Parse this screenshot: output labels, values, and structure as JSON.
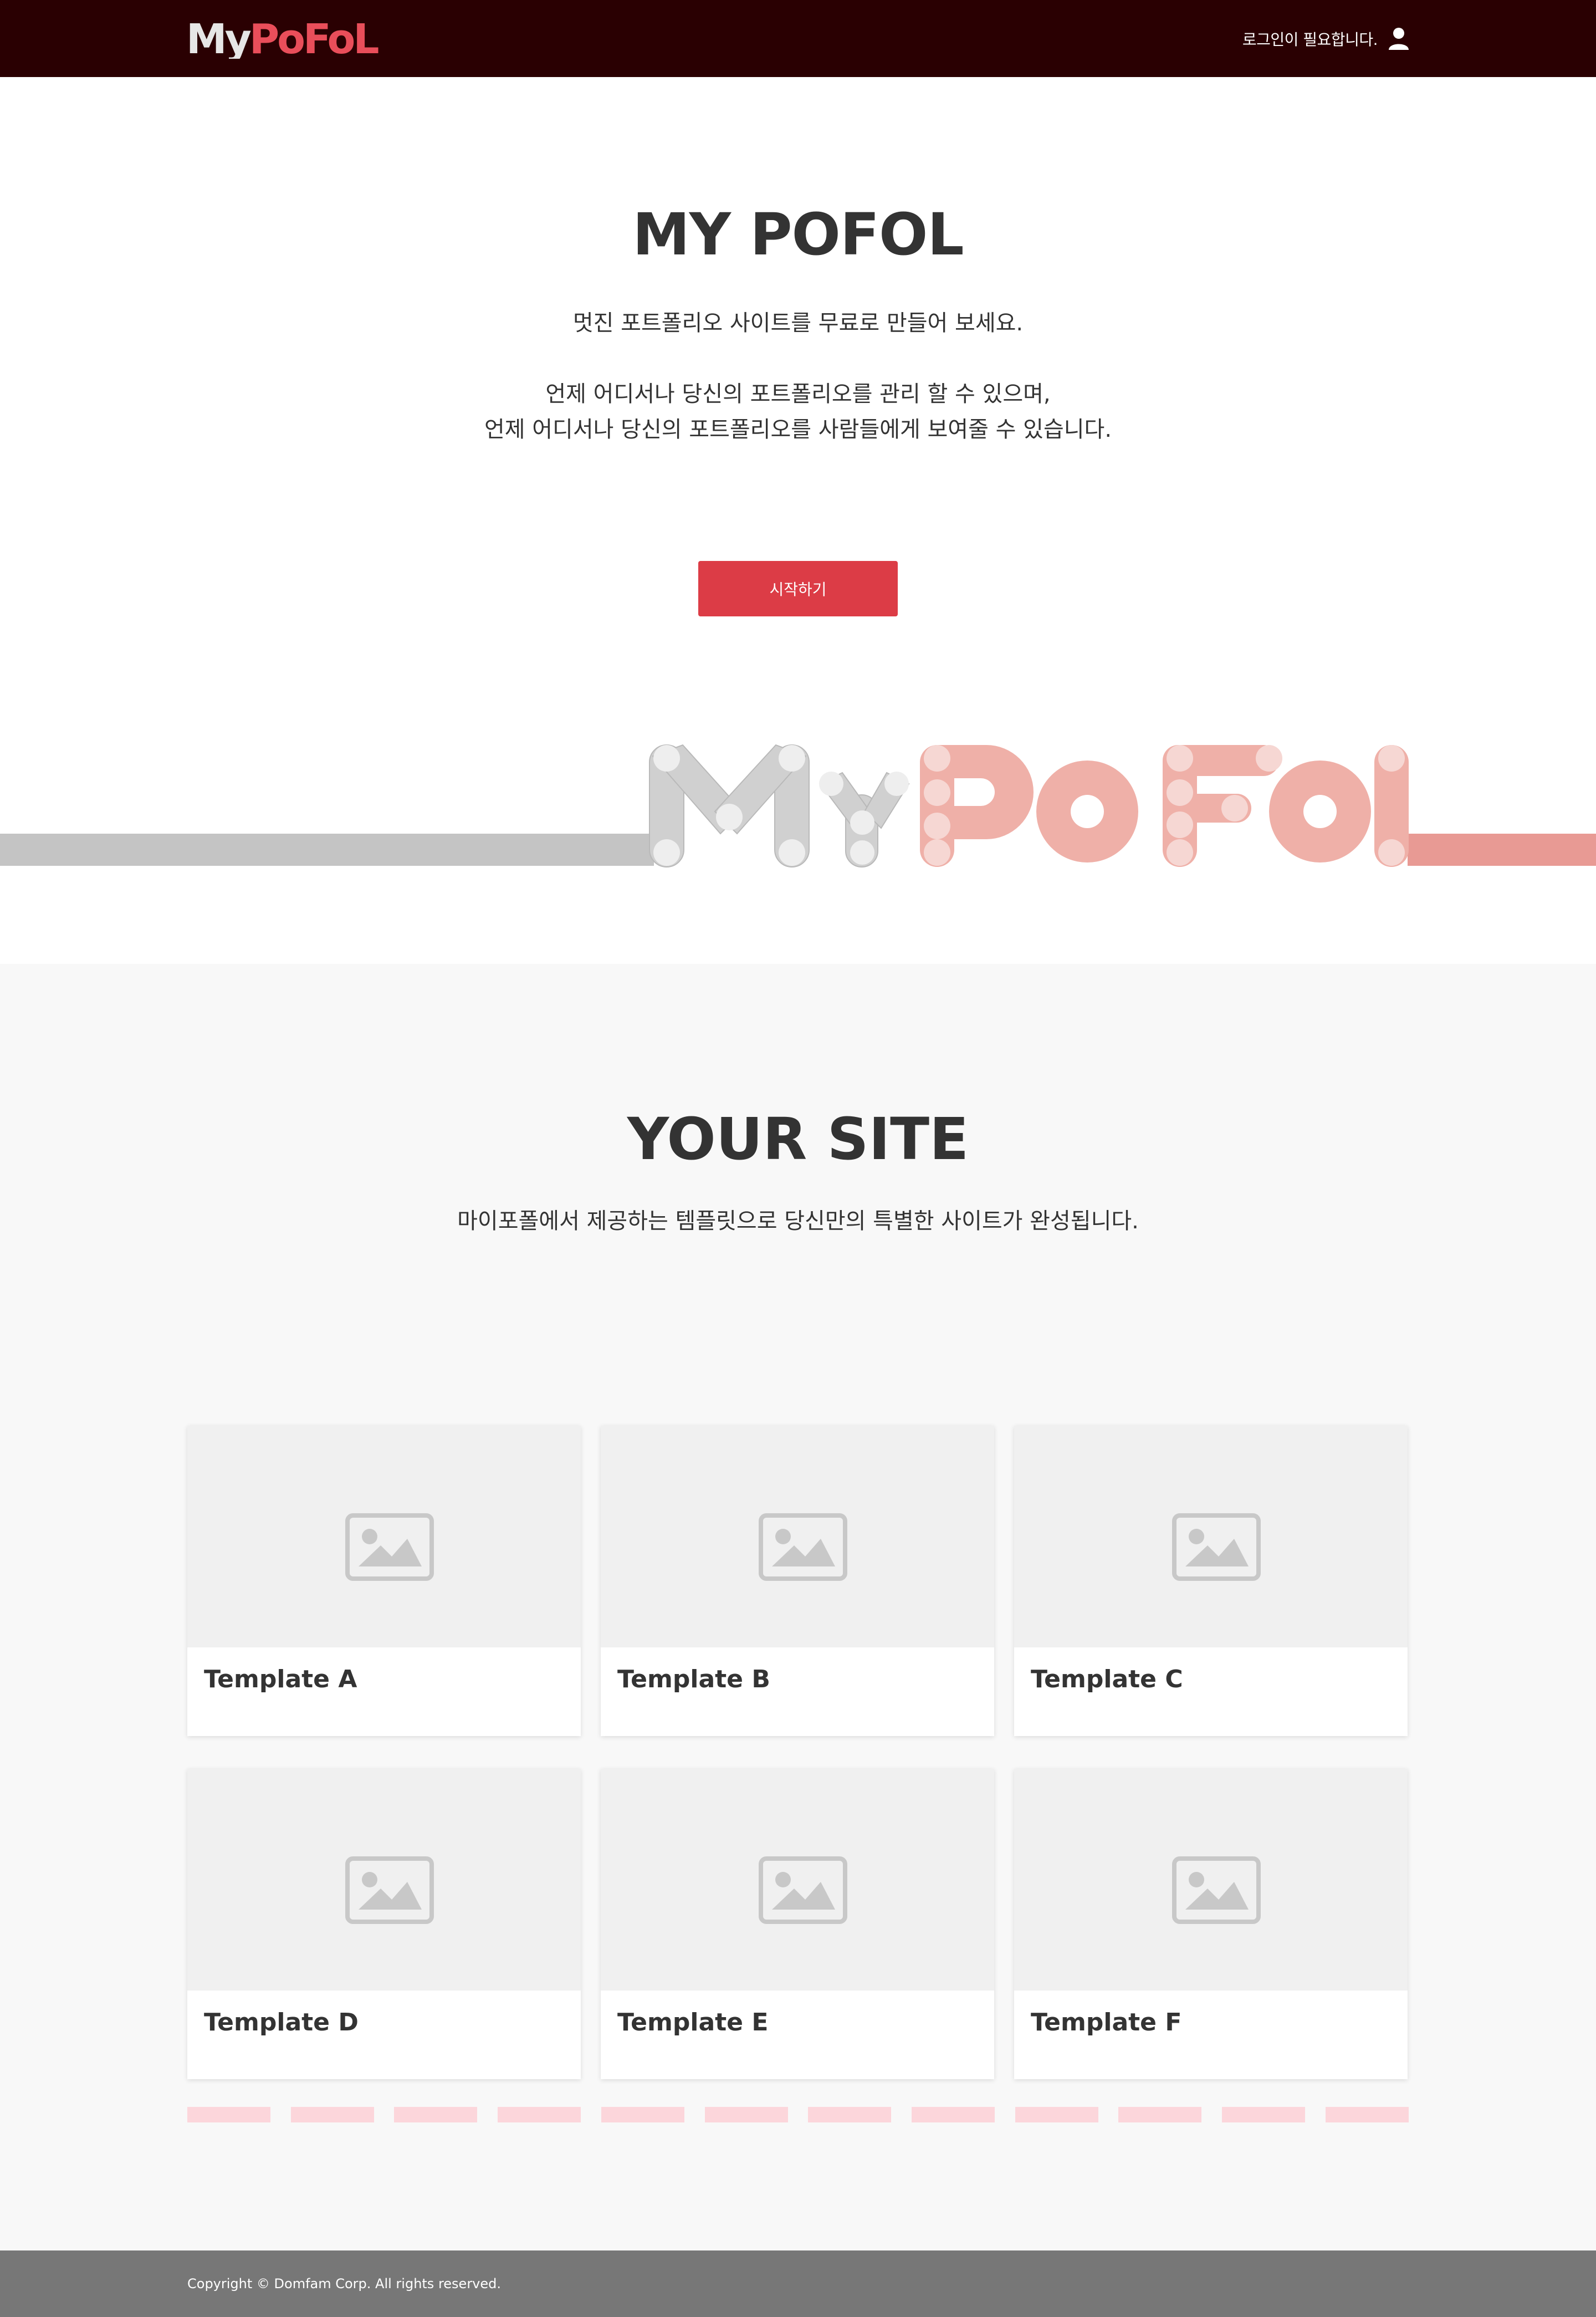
{
  "header": {
    "logo_text": "MyPoFoL",
    "login_text": "로그인이 필요합니다.",
    "icon": "user-icon"
  },
  "hero": {
    "title": "MY POFOL",
    "line1": "멋진 포트폴리오 사이트를 무료로 만들어 보세요.",
    "line2": "언제 어디서나 당신의 포트폴리오를 관리 할 수 있으며,",
    "line3": "언제 어디서나 당신의 포트폴리오를 사람들에게 보여줄 수 있습니다.",
    "start_button": "시작하기",
    "art_text": "MyPoFol"
  },
  "site": {
    "title": "YOUR SITE",
    "subtitle": "마이포폴에서 제공하는 템플릿으로 당신만의 특별한 사이트가 완성됩니다.",
    "templates": [
      {
        "label": "Template A",
        "icon": "image-placeholder-icon"
      },
      {
        "label": "Template B",
        "icon": "image-placeholder-icon"
      },
      {
        "label": "Template C",
        "icon": "image-placeholder-icon"
      },
      {
        "label": "Template D",
        "icon": "image-placeholder-icon"
      },
      {
        "label": "Template E",
        "icon": "image-placeholder-icon"
      },
      {
        "label": "Template F",
        "icon": "image-placeholder-icon"
      }
    ],
    "pager_count": 12
  },
  "footer": {
    "copyright": "Copyright © Domfam Corp. All rights reserved."
  },
  "colors": {
    "header_bg": "#2a0002",
    "accent": "#dc3c46",
    "pager": "#fcd6db",
    "footer_bg": "#777777",
    "section_bg": "#f8f8f8"
  }
}
